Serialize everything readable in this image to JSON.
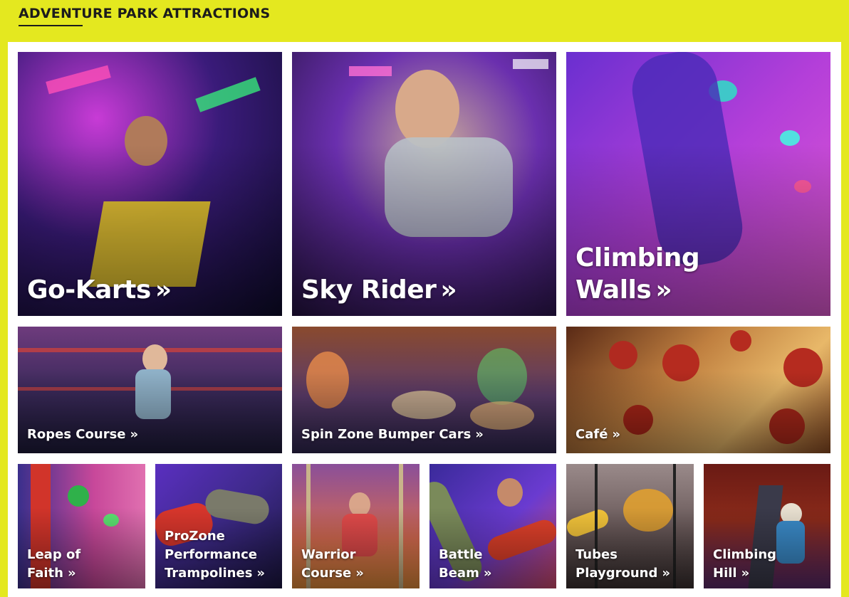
{
  "section": {
    "title": "ADVENTURE PARK ATTRACTIONS"
  },
  "arrow_glyph": "»",
  "colors": {
    "background": "#e4e81f",
    "panel": "#ffffff",
    "title": "#1c1c1c",
    "label": "#ffffff"
  },
  "attractions": [
    {
      "label": "Go-Karts",
      "size": "big"
    },
    {
      "label": "Sky Rider",
      "size": "big"
    },
    {
      "label": "Climbing\nWalls",
      "size": "big"
    },
    {
      "label": "Ropes Course",
      "size": "mid"
    },
    {
      "label": "Spin Zone Bumper Cars",
      "size": "mid"
    },
    {
      "label": "Café",
      "size": "mid"
    },
    {
      "label": "Leap of\nFaith",
      "size": "small"
    },
    {
      "label": "ProZone\nPerformance\nTrampolines",
      "size": "small"
    },
    {
      "label": "Warrior\nCourse",
      "size": "small"
    },
    {
      "label": "Battle\nBeam",
      "size": "small"
    },
    {
      "label": "Tubes\nPlayground",
      "size": "small"
    },
    {
      "label": "Climbing\nHill",
      "size": "small"
    }
  ]
}
